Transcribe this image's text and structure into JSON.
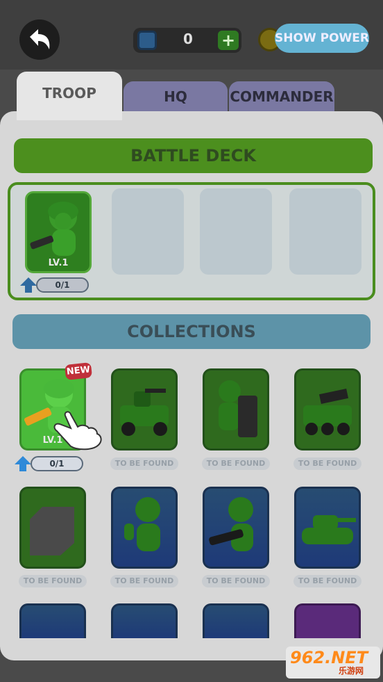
{
  "header": {
    "gem_count": "0",
    "plus_label": "+",
    "show_power_label": "SHOW POWER"
  },
  "tabs": [
    {
      "label": "TROOP",
      "active": true
    },
    {
      "label": "HQ",
      "active": false
    },
    {
      "label": "COMMANDER",
      "active": false
    }
  ],
  "battle_deck": {
    "title": "BATTLE DECK",
    "card": {
      "level": "LV.1",
      "progress": "0/1"
    }
  },
  "collections": {
    "title": "COLLECTIONS",
    "first_card": {
      "level": "LV.1",
      "progress": "0/1",
      "badge": "NEW"
    },
    "not_found_label": "TO BE FOUND"
  },
  "watermark": {
    "text": "962.NET",
    "sub": "乐游网"
  },
  "colors": {
    "deck_green": "#4c8f1e",
    "collection_blue": "#5d93a8",
    "show_power": "#64b3d3",
    "tab_inactive": "#7a78a2"
  }
}
